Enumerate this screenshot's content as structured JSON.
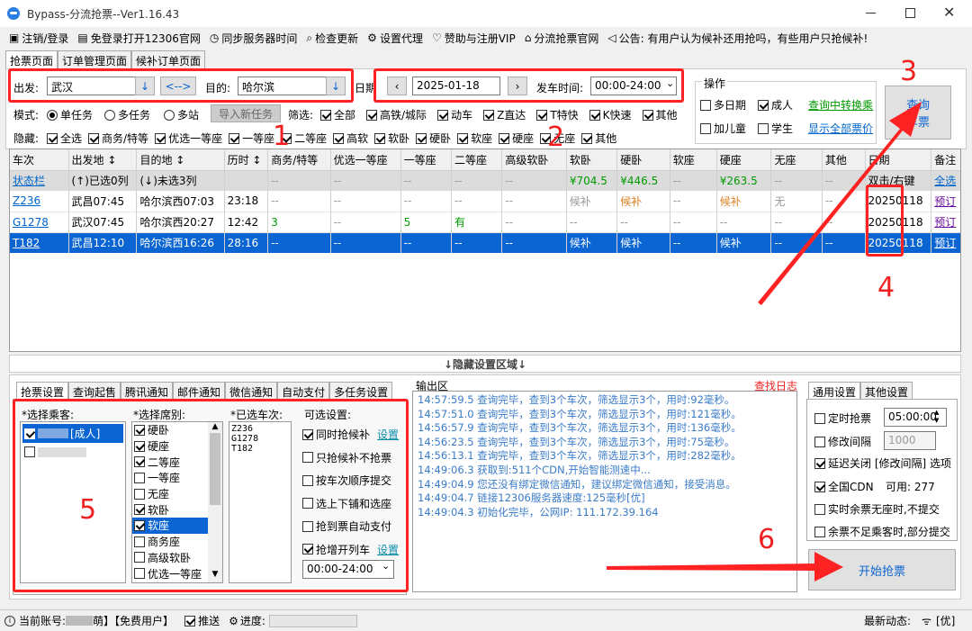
{
  "window": {
    "title": "Bypass-分流抢票--Ver1.16.43"
  },
  "menubar": [
    {
      "icon": "logout-icon",
      "label": "注销/登录"
    },
    {
      "icon": "browser-icon",
      "label": "免登录打开12306官网"
    },
    {
      "icon": "clock-icon",
      "label": "同步服务器时间"
    },
    {
      "icon": "search-icon",
      "label": "检查更新"
    },
    {
      "icon": "gear-icon",
      "label": "设置代理"
    },
    {
      "icon": "heart-icon",
      "label": "赞助与注册VIP"
    },
    {
      "icon": "home-icon",
      "label": "分流抢票官网"
    },
    {
      "icon": "speaker-icon",
      "label": "公告: 有用户认为候补还用抢吗，有些用户只抢候补!"
    }
  ],
  "main_tabs": [
    "抢票页面",
    "订单管理页面",
    "候补订单页面"
  ],
  "search": {
    "from_label": "出发:",
    "from": "武汉",
    "to_label": "目的:",
    "to": "哈尔滨",
    "swap": "<-->",
    "date_label": "日期",
    "date": "2025-01-18",
    "depart_label": "发车时间:",
    "depart": "00:00-24:00"
  },
  "ops": {
    "title": "操作",
    "multi_date": "多日期",
    "adult": "成人",
    "transfer": "查询中转换乘",
    "child": "加儿童",
    "student": "学生",
    "show_all": "显示全部票价",
    "query_button": "查询\n车票"
  },
  "mode": {
    "label": "模式:",
    "options": [
      "单任务",
      "多任务",
      "多站"
    ],
    "import": "导入新任务"
  },
  "filter": {
    "label": "筛选:",
    "items": [
      "全部",
      "高铁/城际",
      "动车",
      "Z直达",
      "T特快",
      "K快速",
      "其他"
    ]
  },
  "hide": {
    "label": "隐藏:",
    "items": [
      "全选",
      "商务/特等",
      "优选一等座",
      "一等座",
      "二等座",
      "高软",
      "软卧",
      "硬卧",
      "软座",
      "硬座",
      "无座",
      "其他"
    ]
  },
  "table": {
    "headers": [
      "车次",
      "出发地 ↕",
      "目的地 ↕",
      "历时 ↕",
      "商务/特等",
      "优选一等座",
      "一等座",
      "二等座",
      "高级软卧",
      "软卧",
      "硬卧",
      "软座",
      "硬座",
      "无座",
      "其他",
      "日期",
      "备注"
    ],
    "status_row": [
      "状态栏",
      "(↑)已选0列",
      "(↓)未选3列",
      "",
      "--",
      "--",
      "--",
      "--",
      "--",
      "¥704.5",
      "¥446.5",
      "--",
      "¥263.5",
      "--",
      "--",
      "双击/右键",
      "全选"
    ],
    "rows": [
      [
        "Z236",
        "武昌07:45",
        "哈尔滨西07:03",
        "23:18",
        "--",
        "--",
        "--",
        "--",
        "--",
        "候补",
        "候补",
        "--",
        "候补",
        "无",
        "--",
        "20250118",
        "预订"
      ],
      [
        "G1278",
        "武汉07:45",
        "哈尔滨西20:27",
        "12:42",
        "3",
        "--",
        "5",
        "有",
        "--",
        "--",
        "--",
        "--",
        "--",
        "--",
        "--",
        "20250118",
        "预订"
      ],
      [
        "T182",
        "武昌12:10",
        "哈尔滨西16:26",
        "28:16",
        "--",
        "--",
        "--",
        "--",
        "--",
        "候补",
        "候补",
        "--",
        "候补",
        "--",
        "--",
        "20250118",
        "预订"
      ]
    ]
  },
  "hidden_area": "↓隐藏设置区域↓",
  "bottom_tabs": [
    "抢票设置",
    "查询起售",
    "腾讯通知",
    "邮件通知",
    "微信通知",
    "自动支付",
    "多任务设置"
  ],
  "passengers": {
    "label": "*选择乘客:",
    "items": [
      {
        "name": "[成人]",
        "checked": true
      },
      {
        "name": "",
        "checked": false
      }
    ]
  },
  "seats": {
    "label": "*选择席别:",
    "items": [
      {
        "n": "硬卧",
        "c": true
      },
      {
        "n": "硬座",
        "c": true
      },
      {
        "n": "二等座",
        "c": true
      },
      {
        "n": "一等座",
        "c": false
      },
      {
        "n": "无座",
        "c": false
      },
      {
        "n": "软卧",
        "c": true
      },
      {
        "n": "软座",
        "c": true
      },
      {
        "n": "商务座",
        "c": false
      },
      {
        "n": "高级软卧",
        "c": false
      },
      {
        "n": "优选一等座",
        "c": false
      }
    ]
  },
  "selected_trains": {
    "label": "*已选车次:",
    "items": [
      "Z236",
      "G1278",
      "T182"
    ]
  },
  "options": {
    "label": "可选设置:",
    "items": [
      {
        "t": "同时抢候补",
        "c": true,
        "link": "设置"
      },
      {
        "t": "只抢候补不抢票",
        "c": false
      },
      {
        "t": "按车次顺序提交",
        "c": false
      },
      {
        "t": "选上下铺和选座",
        "c": false
      },
      {
        "t": "抢到票自动支付",
        "c": false
      },
      {
        "t": "抢增开列车",
        "c": true,
        "link": "设置"
      }
    ],
    "time": "00:00-24:00"
  },
  "output": {
    "label": "输出区",
    "log_link": "查找日志",
    "lines": [
      "14:57:59.5  查询完毕，查到3个车次，筛选显示3个，用时:92毫秒。",
      "14:57:51.0  查询完毕，查到3个车次，筛选显示3个，用时:121毫秒。",
      "14:56:57.9  查询完毕，查到3个车次，筛选显示3个，用时:136毫秒。",
      "14:56:23.5  查询完毕，查到3个车次，筛选显示3个，用时:75毫秒。",
      "14:56:13.1  查询完毕，查到3个车次，筛选显示3个，用时:282毫秒。",
      "14:49:06.3  获取到:511个CDN,开始智能测速中...",
      "14:49:04.9  您还没有绑定微信通知，建议绑定微信通知，接受消息。",
      "14:49:04.7  链接12306服务器速度:125毫秒[优]",
      "14:49:04.3  初始化完毕，公网IP: 111.172.39.164"
    ]
  },
  "general": {
    "tabs": [
      "通用设置",
      "其他设置"
    ],
    "timed": "定时抢票",
    "timed_value": "05:00:00",
    "interval": "修改间隔",
    "interval_value": "1000",
    "delay": "延迟关闭 [修改间隔] 选项",
    "cdn": "全国CDN",
    "cdn_avail": "可用: 277",
    "realtime": "实时余票无座时,不提交",
    "partial": "余票不足乘客时,部分提交",
    "start_button": "开始抢票"
  },
  "statusbar": {
    "account": "当前账号:",
    "account_suffix": "萌】【免费用户】",
    "push": "推送",
    "progress": "进度:",
    "news": "最新动态:",
    "speed": "[优]"
  },
  "annotations": [
    "1",
    "2",
    "3",
    "4",
    "5",
    "6"
  ],
  "colors": {
    "accent": "#0078d7",
    "selected_row": "#0a64d2",
    "annotation": "#f02020"
  }
}
